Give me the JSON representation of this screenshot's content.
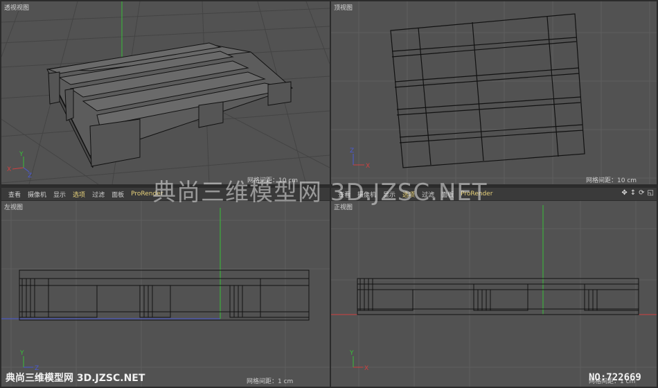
{
  "viewports": {
    "perspective": {
      "title": "透视视图",
      "grid_spacing": "网格间距：10 cm"
    },
    "top": {
      "title": "顶视图",
      "grid_spacing": "网格间距：10 cm"
    },
    "left": {
      "title": "左视图",
      "grid_spacing": "网格间距：1 cm"
    },
    "front": {
      "title": "正视图",
      "grid_spacing": "网格间距：1 cm"
    }
  },
  "menu": {
    "items": [
      "查看",
      "摄像机",
      "显示",
      "选项",
      "过滤",
      "面板",
      "ProRender"
    ],
    "highlighted_index": 3
  },
  "toolbar_icons": [
    "move-icon",
    "scroll-icon",
    "rotate-icon",
    "maximize-icon"
  ],
  "axes": {
    "x": "X",
    "y": "Y",
    "z": "Z"
  },
  "colors": {
    "viewport_bg": "#525252",
    "grid_line": "#5e5e5e",
    "menu_bg": "#3a3a3a",
    "menu_accent": "#e8d27a",
    "axis_x": "#d04040",
    "axis_y": "#38c038",
    "axis_z": "#4a5ad8"
  },
  "watermark": {
    "center_text": "典尚三维模型网 3D.JZSC.NET",
    "bottom_text": "典尚三维模型网 3D.JZSC.NET",
    "number": "NO:722669"
  }
}
